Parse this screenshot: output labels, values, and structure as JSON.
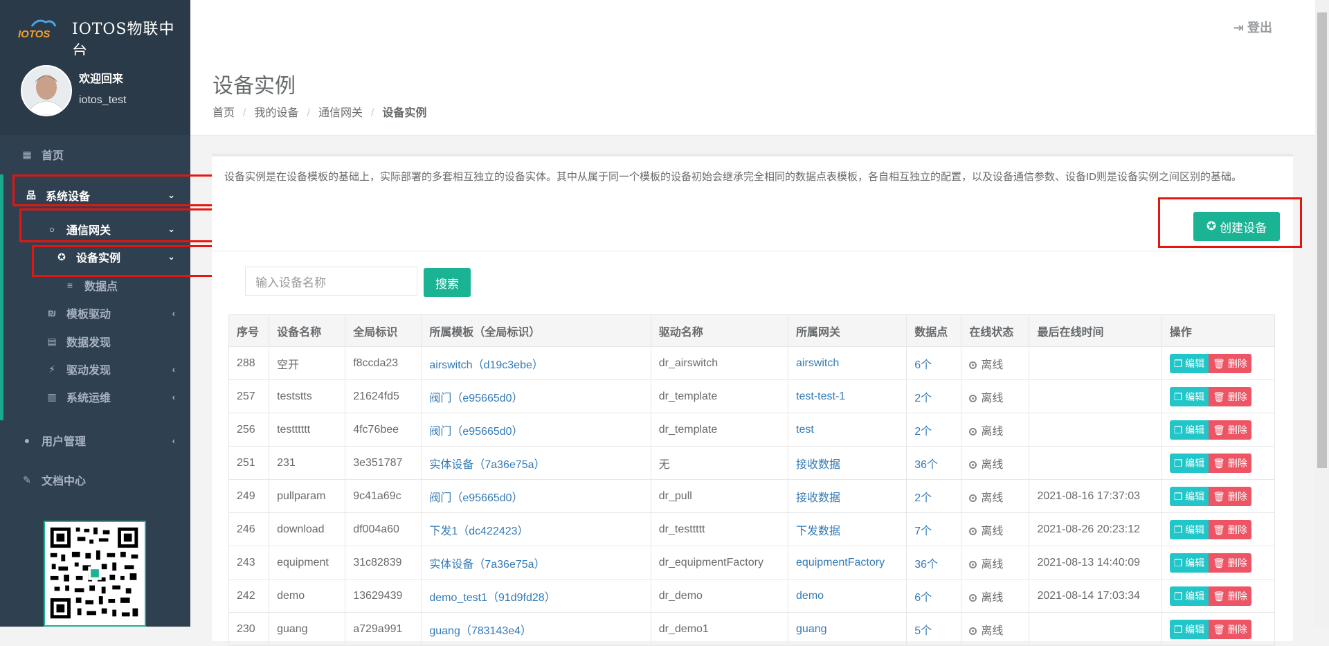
{
  "brand": {
    "logo_text": "IOTOS",
    "title": "IOTOS物联中台"
  },
  "profile": {
    "welcome": "欢迎回来",
    "username": "iotos_test"
  },
  "sidebar": {
    "items": [
      {
        "label": "首页",
        "icon": "dashboard-icon"
      },
      {
        "label": "系统设备",
        "icon": "sitemap-icon"
      },
      {
        "label": "通信网关",
        "icon": "circle-icon"
      },
      {
        "label": "设备实例",
        "icon": "rebel-icon"
      },
      {
        "label": "数据点",
        "icon": "database-icon"
      },
      {
        "label": "模板驱动",
        "icon": "template-icon"
      },
      {
        "label": "数据发现",
        "icon": "table-icon"
      },
      {
        "label": "驱动发现",
        "icon": "plug-icon"
      },
      {
        "label": "系统运维",
        "icon": "bar-chart-icon"
      },
      {
        "label": "用户管理",
        "icon": "user-icon"
      },
      {
        "label": "文档中心",
        "icon": "edit-icon"
      }
    ]
  },
  "topbar": {
    "logout_label": "登出"
  },
  "page": {
    "title": "设备实例",
    "breadcrumbs": [
      "首页",
      "我的设备",
      "通信网关",
      "设备实例"
    ]
  },
  "panel": {
    "description": "设备实例是在设备模板的基础上，实际部署的多套相互独立的设备实体。其中从属于同一个模板的设备初始会继承完全相同的数据点表模板，各自相互独立的配置，以及设备通信参数、设备ID则是设备实例之间区别的基础。",
    "create_label": "创建设备",
    "search_placeholder": "输入设备名称",
    "search_label": "搜索"
  },
  "table": {
    "headers": [
      "序号",
      "设备名称",
      "全局标识",
      "所属模板（全局标识）",
      "驱动名称",
      "所属网关",
      "数据点",
      "在线状态",
      "最后在线时间",
      "操作"
    ],
    "edit_label": "编辑",
    "delete_label": "删除",
    "rows": [
      [
        "288",
        "空开",
        "f8ccda23",
        "airswitch（d19c3ebe）",
        "dr_airswitch",
        "airswitch",
        "6个",
        "离线",
        ""
      ],
      [
        "257",
        "teststts",
        "21624fd5",
        "阀门（e95665d0）",
        "dr_template",
        "test-test-1",
        "2个",
        "离线",
        ""
      ],
      [
        "256",
        "testttttt",
        "4fc76bee",
        "阀门（e95665d0）",
        "dr_template",
        "test",
        "2个",
        "离线",
        ""
      ],
      [
        "251",
        "231",
        "3e351787",
        "实体设备（7a36e75a）",
        "无",
        "接收数据",
        "36个",
        "离线",
        ""
      ],
      [
        "249",
        "pullparam",
        "9c41a69c",
        "阀门（e95665d0）",
        "dr_pull",
        "接收数据",
        "2个",
        "离线",
        "2021-08-16 17:37:03"
      ],
      [
        "246",
        "download",
        "df004a60",
        "下发1（dc422423）",
        "dr_testtttt",
        "下发数据",
        "7个",
        "离线",
        "2021-08-26 20:23:12"
      ],
      [
        "243",
        "equipment",
        "31c82839",
        "实体设备（7a36e75a）",
        "dr_equipmentFactory",
        "equipmentFactory",
        "36个",
        "离线",
        "2021-08-13 14:40:09"
      ],
      [
        "242",
        "demo",
        "13629439",
        "demo_test1（91d9fd28）",
        "dr_demo",
        "demo",
        "6个",
        "离线",
        "2021-08-14 17:03:34"
      ],
      [
        "230",
        "guang",
        "a729a991",
        "guang（783143e4）",
        "dr_demo1",
        "guang",
        "5个",
        "离线",
        ""
      ]
    ]
  }
}
